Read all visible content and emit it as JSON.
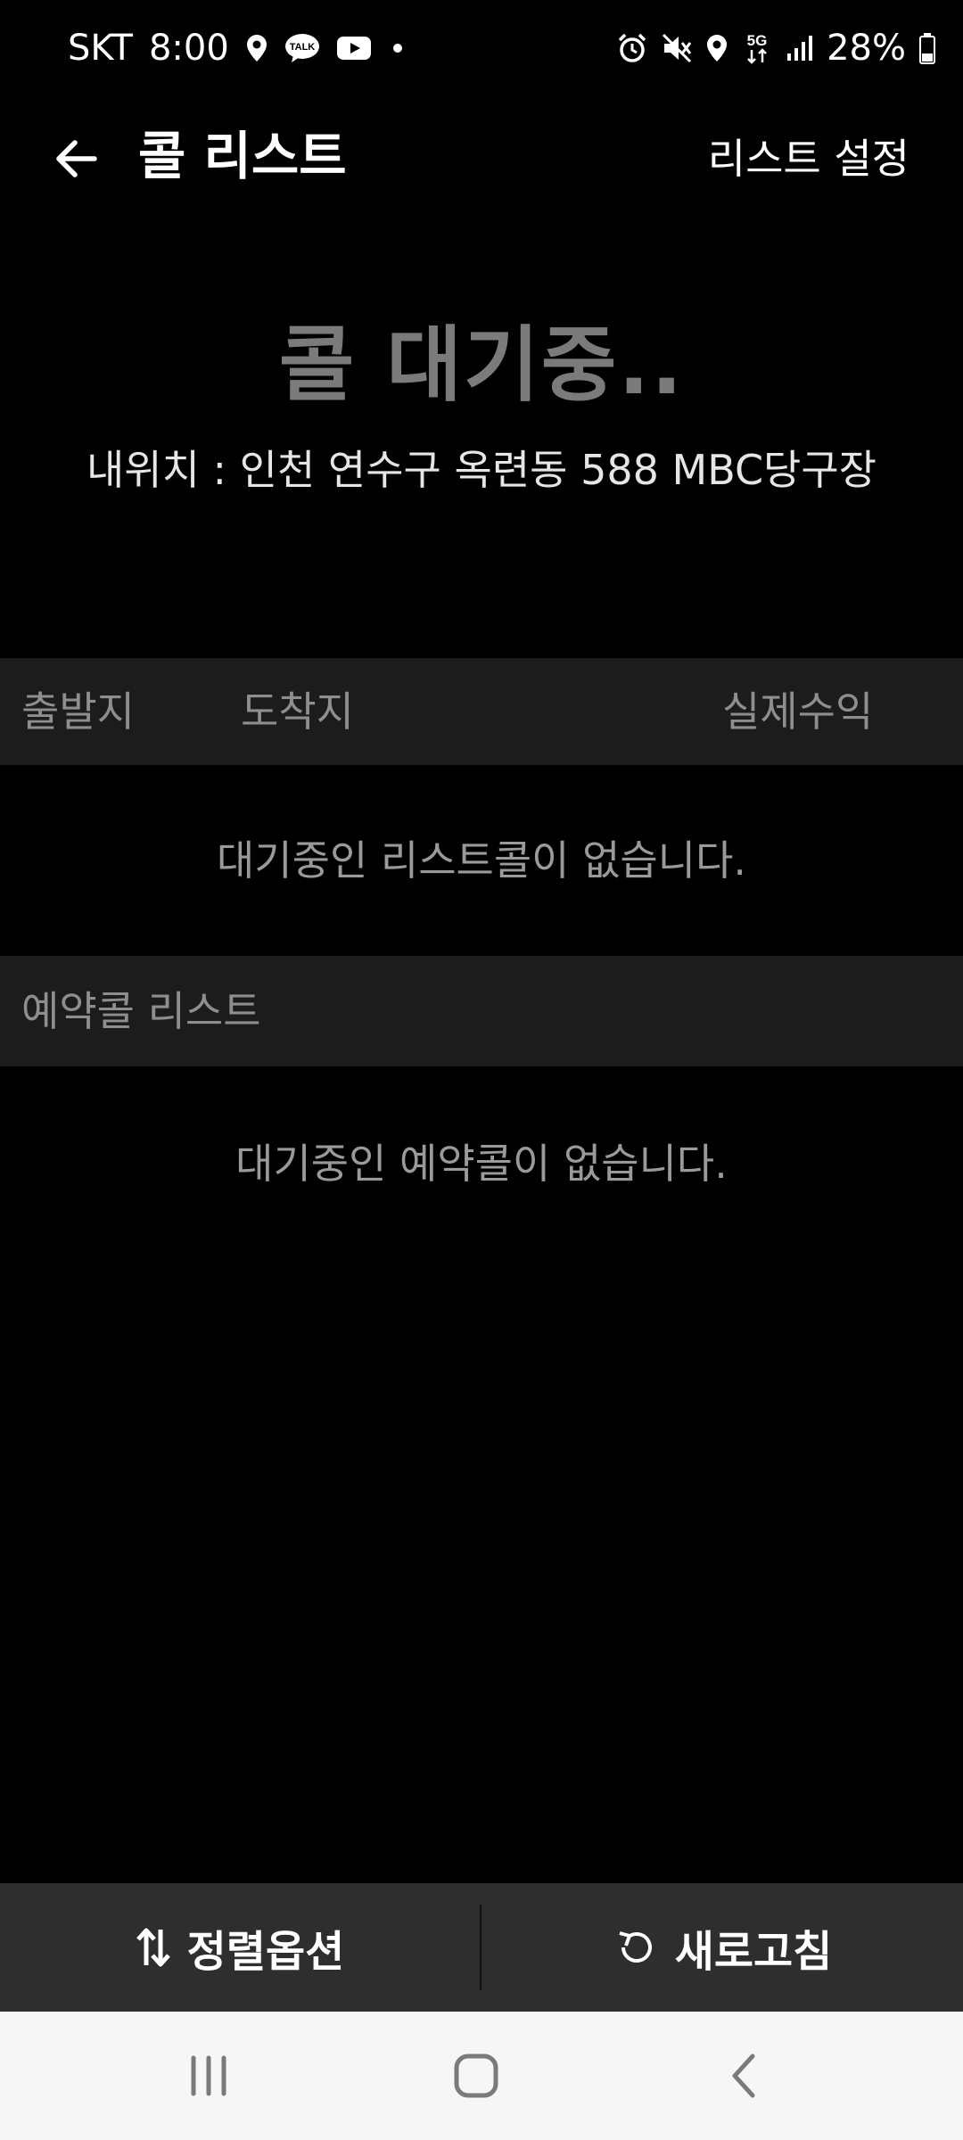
{
  "status_bar": {
    "carrier": "SKT",
    "time": "8:00",
    "talk_label": "TALK",
    "network": "5G",
    "battery": "28%",
    "icons_left": [
      "location-icon",
      "kakaotalk-icon",
      "youtube-icon",
      "dot-icon"
    ],
    "icons_right": [
      "alarm-icon",
      "mute-icon",
      "location-icon",
      "5g-icon",
      "signal-icon",
      "battery-icon"
    ]
  },
  "app_bar": {
    "title": "콜 리스트",
    "settings_label": "리스트 설정"
  },
  "waiting": {
    "title": "콜 대기중..",
    "location": "내위치 : 인천 연수구 옥련동 588 MBC당구장"
  },
  "columns": {
    "departure": "출발지",
    "arrival": "도착지",
    "income": "실제수익"
  },
  "list_empty": "대기중인 리스트콜이 없습니다.",
  "reservation": {
    "title": "예약콜 리스트",
    "empty": "대기중인 예약콜이 없습니다."
  },
  "bottom": {
    "sort_label": "정렬옵션",
    "refresh_label": "새로고침"
  },
  "colors": {
    "background": "#000000",
    "header_bg": "#1c1c1c",
    "bottom_bg": "#2e2e2e",
    "muted_text": "#8e8e8e",
    "nav_bg": "#f6f6f6"
  }
}
